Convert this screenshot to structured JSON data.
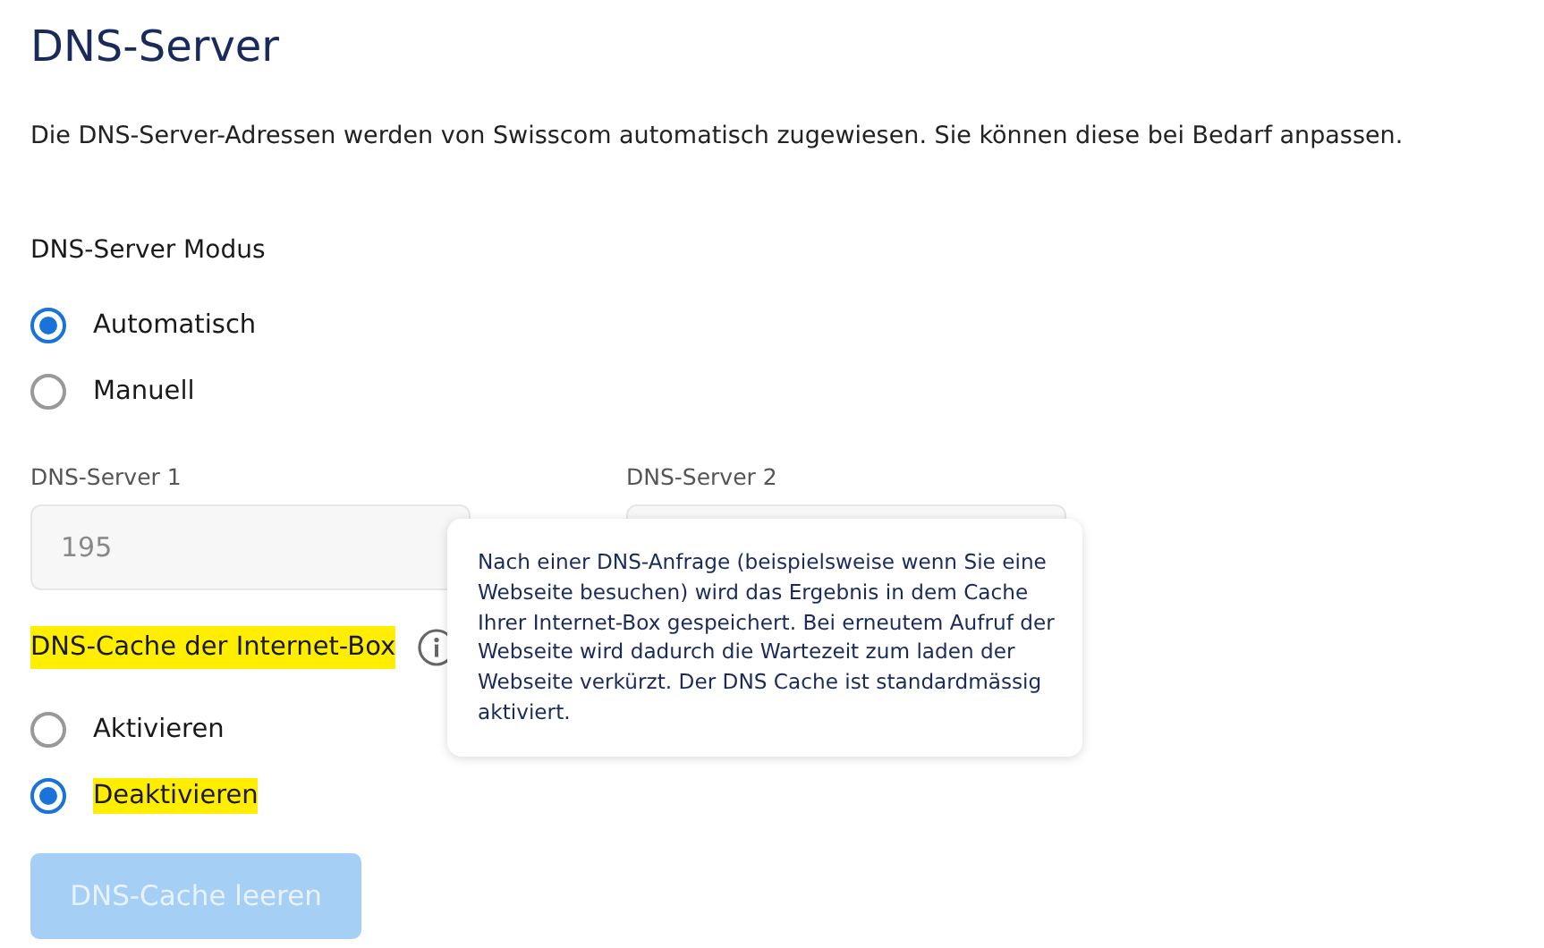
{
  "title": "DNS-Server",
  "description": "Die DNS-Server-Adressen werden von Swisscom automatisch zugewiesen. Sie können diese bei Bedarf anpassen.",
  "mode": {
    "label": "DNS-Server Modus",
    "options": [
      {
        "label": "Automatisch",
        "selected": true,
        "highlighted": false
      },
      {
        "label": "Manuell",
        "selected": false,
        "highlighted": false
      }
    ]
  },
  "fields": [
    {
      "label": "DNS-Server 1",
      "value": "195",
      "disabled": true
    },
    {
      "label": "DNS-Server 2",
      "disabled": true
    }
  ],
  "cache": {
    "label": "DNS-Cache der Internet-Box",
    "highlighted": true,
    "options": [
      {
        "label": "Aktivieren",
        "selected": false,
        "highlighted": false
      },
      {
        "label": "Deaktivieren",
        "selected": true,
        "highlighted": true
      }
    ]
  },
  "tooltip": {
    "text": "Nach einer DNS-Anfrage (beispielsweise wenn Sie eine Webseite besuchen) wird das Ergebnis in dem Cache Ihrer Internet-Box gespeichert. Bei erneutem Aufruf der Webseite wird dadurch die Wartezeit zum laden der Webseite verkürzt. Der DNS Cache ist standardmässig aktiviert."
  },
  "button": {
    "label": "DNS-Cache leeren",
    "disabled": true
  }
}
